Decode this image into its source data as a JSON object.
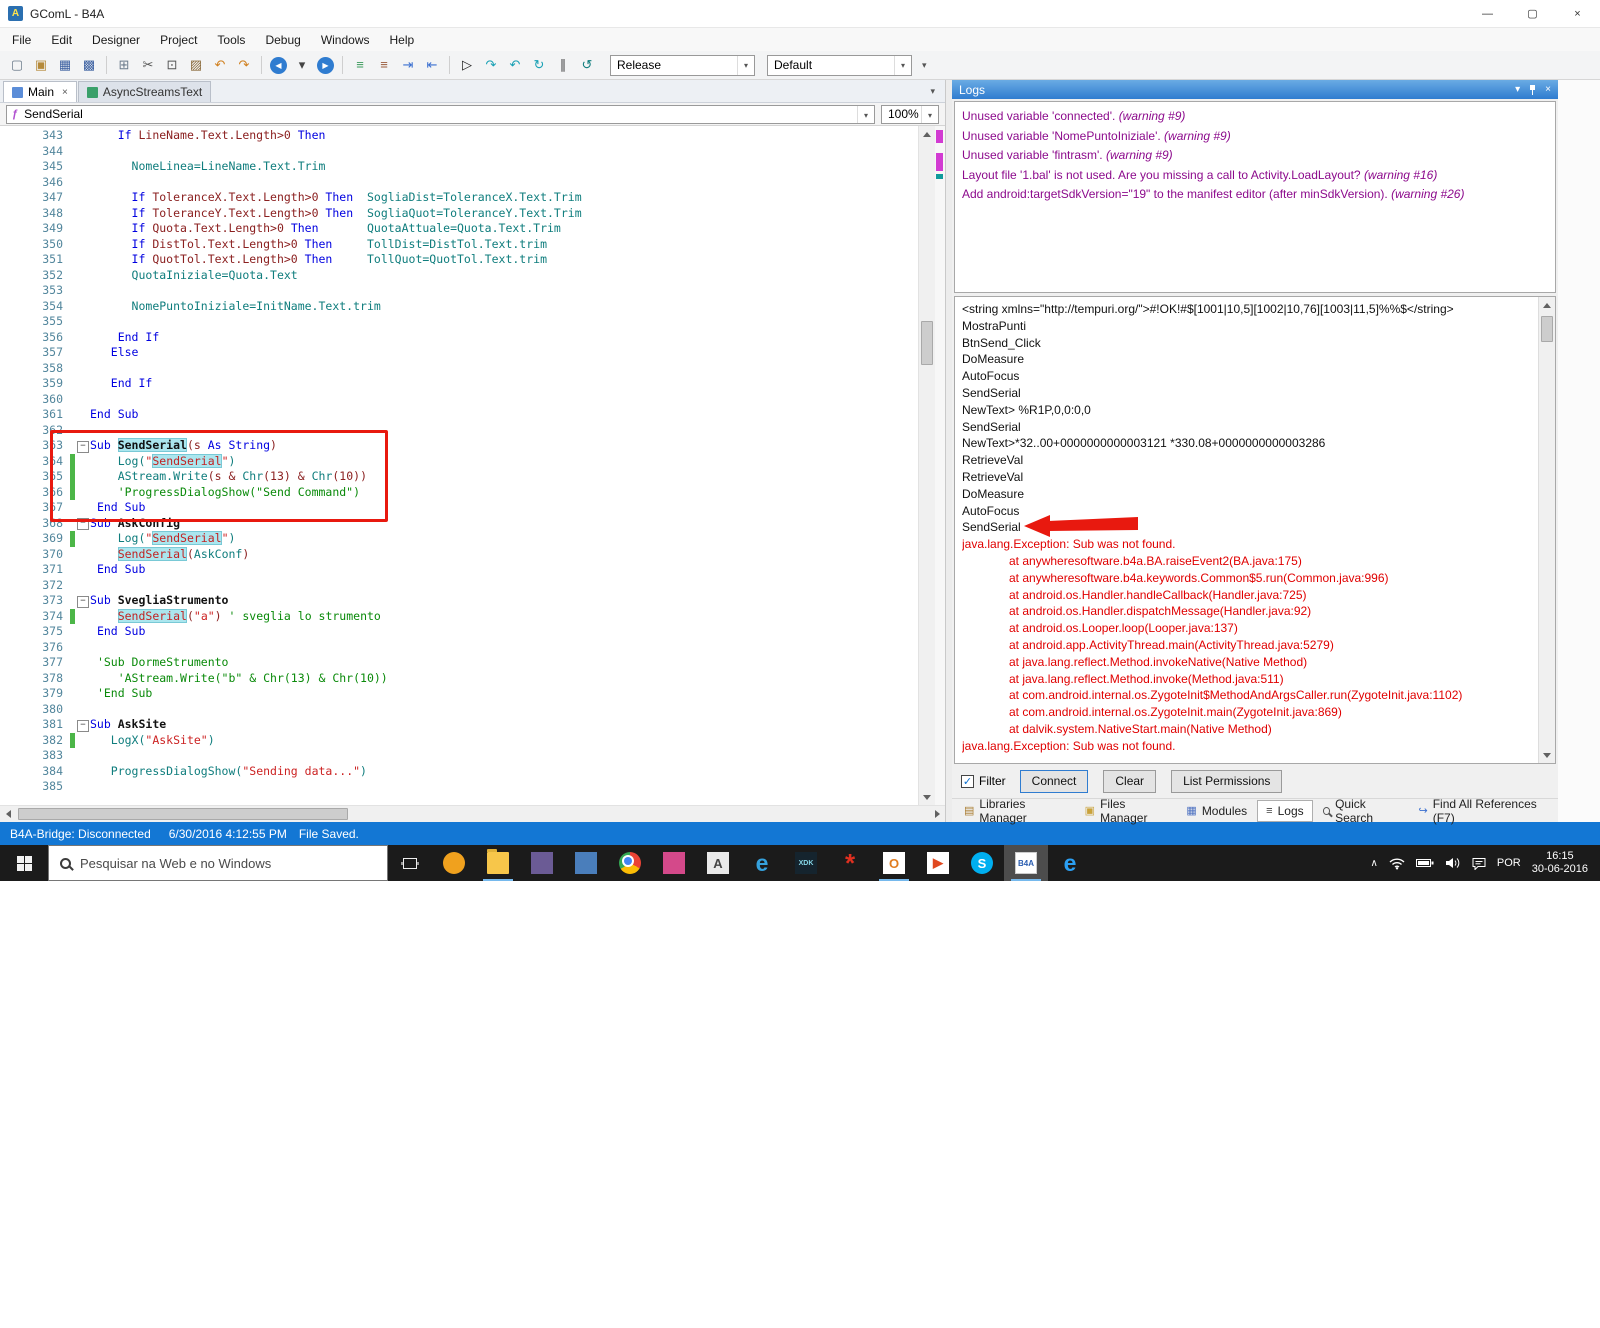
{
  "titlebar": {
    "icon_letter": "A",
    "title": "GComL - B4A",
    "controls": {
      "minimize": "—",
      "maximize": "▢",
      "close": "×"
    }
  },
  "menubar": [
    "File",
    "Edit",
    "Designer",
    "Project",
    "Tools",
    "Debug",
    "Windows",
    "Help"
  ],
  "icons": {
    "dropdown": "▾"
  },
  "toolbar": {
    "release_combo": "Release",
    "default_combo": "Default",
    "icons": [
      {
        "n": "new-file-icon",
        "g": "▢",
        "c": "#6a7a8a"
      },
      {
        "n": "open-file-icon",
        "g": "▣",
        "c": "#b58a3a"
      },
      {
        "n": "save-icon",
        "g": "▦",
        "c": "#3a5fa0"
      },
      {
        "n": "save-all-icon",
        "g": "▩",
        "c": "#3a5fa0"
      },
      {
        "sep": true
      },
      {
        "n": "designer-icon",
        "g": "⊞",
        "c": "#6a7a8a"
      },
      {
        "n": "cut-icon",
        "g": "✂",
        "c": "#555555"
      },
      {
        "n": "copy-icon",
        "g": "⊡",
        "c": "#555555"
      },
      {
        "n": "paste-icon",
        "g": "▨",
        "c": "#8a6a3a"
      },
      {
        "n": "undo-icon",
        "g": "↶",
        "c": "#d08020"
      },
      {
        "n": "redo-icon",
        "g": "↷",
        "c": "#d08020"
      },
      {
        "sep": true
      },
      {
        "n": "navigate-back-icon",
        "g": "◀",
        "c": "#2f7cd0",
        "circle": true
      },
      {
        "n": "back-history-icon",
        "g": "▾",
        "c": "#444444"
      },
      {
        "n": "navigate-forward-icon",
        "g": "▶",
        "c": "#2f7cd0",
        "circle": true
      },
      {
        "sep": true
      },
      {
        "n": "comment-icon",
        "g": "≡",
        "c": "#3a9a5a"
      },
      {
        "n": "uncomment-icon",
        "g": "≡",
        "c": "#9a5a3a"
      },
      {
        "n": "indent-icon",
        "g": "⇥",
        "c": "#3a6fd0"
      },
      {
        "n": "outdent-icon",
        "g": "⇤",
        "c": "#3a6fd0"
      },
      {
        "sep": true
      },
      {
        "n": "run-icon",
        "g": "▷",
        "c": "#222222"
      },
      {
        "n": "step-over-icon",
        "g": "↷",
        "c": "#18a0b4"
      },
      {
        "n": "step-into-icon",
        "g": "↶",
        "c": "#18a0b4"
      },
      {
        "n": "step-out-icon",
        "g": "↻",
        "c": "#18a0b4"
      },
      {
        "n": "pause-icon",
        "g": "∥",
        "c": "#444444"
      },
      {
        "n": "rebuild-icon",
        "g": "↺",
        "c": "#0f7d7d"
      }
    ]
  },
  "editor": {
    "tabs": [
      {
        "label": "Main",
        "active": true,
        "close": "×",
        "icon_color": "#5b8dd8"
      },
      {
        "label": "AsyncStreamsText",
        "icon_color": "#3aa06a"
      }
    ],
    "nav": {
      "icon": "ƒ",
      "value": "SendSerial",
      "zoom": "100%"
    },
    "lines": [
      {
        "n": 343,
        "i": 4,
        "s": [
          [
            "k",
            "If "
          ],
          [
            "p",
            "LineName.Text.Length>0 "
          ],
          [
            "k",
            "Then"
          ]
        ]
      },
      {
        "n": 344
      },
      {
        "n": 345,
        "i": 6,
        "s": [
          [
            "t",
            "NomeLinea=LineName.Text.Trim"
          ]
        ]
      },
      {
        "n": 346
      },
      {
        "n": 347,
        "i": 6,
        "s": [
          [
            "k",
            "If "
          ],
          [
            "p",
            "ToleranceX.Text.Length>0 "
          ],
          [
            "k",
            "Then"
          ],
          [
            "p",
            "  "
          ],
          [
            "t",
            "SogliaDist=ToleranceX.Text.Trim"
          ]
        ]
      },
      {
        "n": 348,
        "i": 6,
        "s": [
          [
            "k",
            "If "
          ],
          [
            "p",
            "ToleranceY.Text.Length>0 "
          ],
          [
            "k",
            "Then"
          ],
          [
            "p",
            "  "
          ],
          [
            "t",
            "SogliaQuot=ToleranceY.Text.Trim"
          ]
        ]
      },
      {
        "n": 349,
        "i": 6,
        "s": [
          [
            "k",
            "If "
          ],
          [
            "p",
            "Quota.Text.Length>0 "
          ],
          [
            "k",
            "Then"
          ],
          [
            "p",
            "       "
          ],
          [
            "t",
            "QuotaAttuale=Quota.Text.Trim"
          ]
        ]
      },
      {
        "n": 350,
        "i": 6,
        "s": [
          [
            "k",
            "If "
          ],
          [
            "p",
            "DistTol.Text.Length>0 "
          ],
          [
            "k",
            "Then"
          ],
          [
            "p",
            "     "
          ],
          [
            "t",
            "TollDist=DistTol.Text.trim"
          ]
        ]
      },
      {
        "n": 351,
        "i": 6,
        "s": [
          [
            "k",
            "If "
          ],
          [
            "p",
            "QuotTol.Text.Length>0 "
          ],
          [
            "k",
            "Then"
          ],
          [
            "p",
            "     "
          ],
          [
            "t",
            "TollQuot=QuotTol.Text.trim"
          ]
        ]
      },
      {
        "n": 352,
        "i": 6,
        "s": [
          [
            "t",
            "QuotaIniziale=Quota.Text"
          ]
        ]
      },
      {
        "n": 353
      },
      {
        "n": 354,
        "i": 6,
        "s": [
          [
            "t",
            "NomePuntoIniziale=InitName.Text.trim"
          ]
        ]
      },
      {
        "n": 355
      },
      {
        "n": 356,
        "i": 4,
        "s": [
          [
            "k",
            "End If"
          ]
        ]
      },
      {
        "n": 357,
        "i": 3,
        "s": [
          [
            "k",
            "Else"
          ]
        ]
      },
      {
        "n": 358
      },
      {
        "n": 359,
        "i": 3,
        "s": [
          [
            "k",
            "End If"
          ]
        ]
      },
      {
        "n": 360
      },
      {
        "n": 361,
        "s": [
          [
            "k",
            "End Sub"
          ]
        ]
      },
      {
        "n": 362
      },
      {
        "n": 363,
        "f": true,
        "s": [
          [
            "k",
            "Sub "
          ],
          [
            "bh",
            "SendSerial"
          ],
          [
            "p",
            "(s "
          ],
          [
            "k",
            "As String"
          ],
          [
            "p",
            ")"
          ]
        ]
      },
      {
        "n": 364,
        "i": 4,
        "b": true,
        "s": [
          [
            "t",
            "Log("
          ],
          [
            "s",
            "\""
          ],
          [
            "h",
            "SendSerial"
          ],
          [
            "s",
            "\""
          ],
          [
            "t",
            ")"
          ]
        ]
      },
      {
        "n": 365,
        "i": 4,
        "b": true,
        "s": [
          [
            "t",
            "AStream.Write"
          ],
          [
            "p",
            "(s & "
          ],
          [
            "t",
            "Chr"
          ],
          [
            "p",
            "(13) & "
          ],
          [
            "t",
            "Chr"
          ],
          [
            "p",
            "(10))"
          ]
        ]
      },
      {
        "n": 366,
        "i": 4,
        "b": true,
        "s": [
          [
            "c",
            "'ProgressDialogShow(\"Send Command\")"
          ]
        ]
      },
      {
        "n": 367,
        "i": 1,
        "s": [
          [
            "k",
            "End Sub"
          ]
        ]
      },
      {
        "n": 368,
        "f": true,
        "s": [
          [
            "k",
            "Sub "
          ],
          [
            "b",
            "AskConfig"
          ]
        ]
      },
      {
        "n": 369,
        "i": 4,
        "b": true,
        "s": [
          [
            "t",
            "Log("
          ],
          [
            "s",
            "\""
          ],
          [
            "h",
            "SendSerial"
          ],
          [
            "s",
            "\""
          ],
          [
            "t",
            ")"
          ]
        ]
      },
      {
        "n": 370,
        "i": 4,
        "s": [
          [
            "h",
            "SendSerial"
          ],
          [
            "p",
            "("
          ],
          [
            "t",
            "AskConf"
          ],
          [
            "p",
            ")"
          ]
        ]
      },
      {
        "n": 371,
        "i": 1,
        "s": [
          [
            "k",
            "End Sub"
          ]
        ]
      },
      {
        "n": 372
      },
      {
        "n": 373,
        "f": true,
        "s": [
          [
            "k",
            "Sub "
          ],
          [
            "b",
            "SvegliaStrumento"
          ]
        ]
      },
      {
        "n": 374,
        "i": 4,
        "b": true,
        "s": [
          [
            "h",
            "SendSerial"
          ],
          [
            "p",
            "("
          ],
          [
            "s",
            "\"a\""
          ],
          [
            "p",
            ") "
          ],
          [
            "c",
            "' sveglia lo strumento"
          ]
        ]
      },
      {
        "n": 375,
        "i": 1,
        "s": [
          [
            "k",
            "End Sub"
          ]
        ]
      },
      {
        "n": 376
      },
      {
        "n": 377,
        "i": 1,
        "s": [
          [
            "c",
            "'Sub DormeStrumento"
          ]
        ]
      },
      {
        "n": 378,
        "i": 4,
        "s": [
          [
            "c",
            "'AStream.Write(\"b\" & Chr(13) & Chr(10))"
          ]
        ]
      },
      {
        "n": 379,
        "i": 1,
        "s": [
          [
            "c",
            "'End Sub"
          ]
        ]
      },
      {
        "n": 380
      },
      {
        "n": 381,
        "f": true,
        "s": [
          [
            "k",
            "Sub "
          ],
          [
            "b",
            "AskSite"
          ]
        ]
      },
      {
        "n": 382,
        "i": 3,
        "b": true,
        "s": [
          [
            "t",
            "LogX("
          ],
          [
            "s",
            "\"AskSite\""
          ],
          [
            "t",
            ")"
          ]
        ]
      },
      {
        "n": 383
      },
      {
        "n": 384,
        "i": 3,
        "s": [
          [
            "t",
            "ProgressDialogShow("
          ],
          [
            "s",
            "\"Sending data...\""
          ],
          [
            "t",
            ")"
          ]
        ]
      },
      {
        "n": 385
      }
    ]
  },
  "logs": {
    "title": "Logs",
    "header_icons": {
      "menu": "▾",
      "close": "×"
    },
    "warnings": [
      {
        "t": "Unused variable 'connected'. ",
        "w": "(warning #9)"
      },
      {
        "t": "Unused variable 'NomePuntoIniziale'. ",
        "w": "(warning #9)"
      },
      {
        "t": "Unused variable 'fintrasm'. ",
        "w": "(warning #9)"
      },
      {
        "t": "Layout file '1.bal' is not used. Are you missing a call to Activity.LoadLayout? ",
        "w": "(warning #16)"
      },
      {
        "t": "Add android:targetSdkVersion=\"19\" to the manifest editor (after minSdkVersion). ",
        "w": "(warning #26)"
      }
    ],
    "entries": [
      {
        "t": "<string xmlns=\"http://tempuri.org/\">#!OK!#$[1001|10,5][1002|10,76][1003|11,5]%%$</string>"
      },
      {
        "t": "MostraPunti"
      },
      {
        "t": "BtnSend_Click"
      },
      {
        "t": "DoMeasure"
      },
      {
        "t": "AutoFocus"
      },
      {
        "t": "SendSerial"
      },
      {
        "t": "NewText> %R1P,0,0:0,0"
      },
      {
        "t": "SendSerial"
      },
      {
        "t": "NewText>*32..00+0000000000003121 *330.08+0000000000003286"
      },
      {
        "t": "RetrieveVal"
      },
      {
        "t": "RetrieveVal"
      },
      {
        "t": "DoMeasure"
      },
      {
        "t": "AutoFocus"
      },
      {
        "t": "SendSerial"
      },
      {
        "t": "java.lang.Exception: Sub  was not found.",
        "red": true
      },
      {
        "t": "at anywheresoftware.b4a.BA.raiseEvent2(BA.java:175)",
        "red": true,
        "at": true
      },
      {
        "t": "at anywheresoftware.b4a.keywords.Common$5.run(Common.java:996)",
        "red": true,
        "at": true
      },
      {
        "t": "at android.os.Handler.handleCallback(Handler.java:725)",
        "red": true,
        "at": true
      },
      {
        "t": "at android.os.Handler.dispatchMessage(Handler.java:92)",
        "red": true,
        "at": true
      },
      {
        "t": "at android.os.Looper.loop(Looper.java:137)",
        "red": true,
        "at": true
      },
      {
        "t": "at android.app.ActivityThread.main(ActivityThread.java:5279)",
        "red": true,
        "at": true
      },
      {
        "t": "at java.lang.reflect.Method.invokeNative(Native Method)",
        "red": true,
        "at": true
      },
      {
        "t": "at java.lang.reflect.Method.invoke(Method.java:511)",
        "red": true,
        "at": true
      },
      {
        "t": "at com.android.internal.os.ZygoteInit$MethodAndArgsCaller.run(ZygoteInit.java:1102)",
        "red": true,
        "at": true
      },
      {
        "t": "at com.android.internal.os.ZygoteInit.main(ZygoteInit.java:869)",
        "red": true,
        "at": true
      },
      {
        "t": "at dalvik.system.NativeStart.main(Native Method)",
        "red": true,
        "at": true
      },
      {
        "t": "java.lang.Exception: Sub  was not found.",
        "red": true
      }
    ],
    "filter": "Filter",
    "check": "✓",
    "buttons": [
      {
        "label": "Connect",
        "primary": true
      },
      {
        "label": "Clear"
      },
      {
        "label": "List Permissions"
      }
    ],
    "tabs": [
      {
        "label": "Libraries Manager",
        "g": "▤",
        "c": "#a97b2e"
      },
      {
        "label": "Files Manager",
        "g": "▣",
        "c": "#c9a23a"
      },
      {
        "label": "Modules",
        "g": "▦",
        "c": "#4a6fc0"
      },
      {
        "label": "Logs",
        "g": "≡",
        "c": "#444444",
        "active": true
      },
      {
        "label": "Quick Search",
        "g": "search",
        "c": "#444444"
      },
      {
        "label": "Find All References (F7)",
        "g": "↪",
        "c": "#3a6fd0"
      }
    ]
  },
  "statusbar": {
    "bridge": "B4A-Bridge: Disconnected",
    "datetime": "6/30/2016 4:12:55 PM",
    "file": "File Saved."
  },
  "taskbar": {
    "search_placeholder": "Pesquisar na Web e no Windows",
    "apps": [
      {
        "n": "honeyview-app",
        "bg": "#f0a11e",
        "g": "",
        "round": true
      },
      {
        "n": "file-explorer-app",
        "cls": "folder-ic",
        "g": "",
        "open": true
      },
      {
        "n": "purple-app",
        "bg": "#6b5b95",
        "g": ""
      },
      {
        "n": "blue-doc-app",
        "bg": "#4a7ebb",
        "g": ""
      },
      {
        "n": "chrome-app",
        "cls": "chrome-ic",
        "g": ""
      },
      {
        "n": "pink-app",
        "bg": "#d4498a",
        "g": ""
      },
      {
        "n": "a-app",
        "bg": "#e9e9e9",
        "fg": "#444444",
        "g": "A"
      },
      {
        "n": "internet-explorer-app",
        "cls": "e-ic",
        "fg": "#35a1dd",
        "g": "e"
      },
      {
        "n": "intel-xdk-app",
        "cls": "xdk-ic",
        "bg": "#15242e",
        "fg": "#86d7e8",
        "g": "XDK"
      },
      {
        "n": "red-star-app",
        "cls": "star-ic",
        "fg": "#e03020",
        "g": "*"
      },
      {
        "n": "outlook-app",
        "bg": "#ffffff",
        "fg": "#e07c1f",
        "g": "O",
        "open": true
      },
      {
        "n": "media-player-app",
        "bg": "#ffffff",
        "fg": "#e0481f",
        "g": "▶"
      },
      {
        "n": "skype-app",
        "bg": "#00aff0",
        "fg": "#ffffff",
        "g": "S",
        "round": true
      },
      {
        "n": "b4a-app",
        "cls": "b4a-ic",
        "bg": "#ffffff",
        "fg": "#2a5db0",
        "g": "B4A",
        "focus": true,
        "open": true
      },
      {
        "n": "edge-app",
        "cls": "e-ic",
        "fg": "#2b9ff2",
        "g": "e"
      }
    ],
    "tray": {
      "chevron": "∧",
      "lang": "POR",
      "time": "16:15",
      "date": "30-06-2016"
    }
  }
}
